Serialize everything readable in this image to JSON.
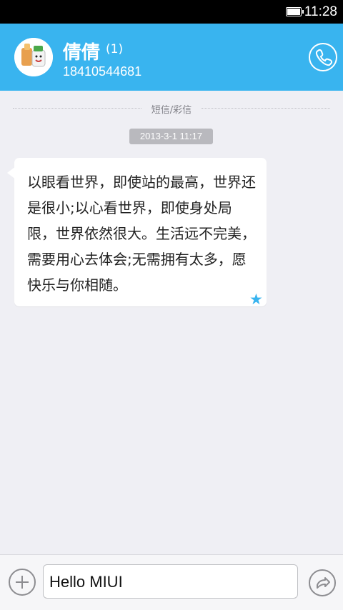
{
  "status_bar": {
    "time": "11:28",
    "battery": 1.0
  },
  "header": {
    "contact_name": "倩倩",
    "unread_count": "(1)",
    "phone_number": "18410544681"
  },
  "thread": {
    "divider_label": "短信/彩信",
    "timestamp": "2013-3-1 11:17",
    "messages": [
      {
        "text": "以眼看世界，即使站的最高，世界还是很小;以心看世界，即使身处局限，世界依然很大。生活远不完美，需要用心去体会;无需拥有太多，愿快乐与你相随。",
        "starred": true
      }
    ]
  },
  "composer": {
    "input_value": "Hello MIUI"
  },
  "icons": {
    "call": "phone-icon",
    "add": "plus-icon",
    "send": "send-icon",
    "star": "star-icon"
  }
}
